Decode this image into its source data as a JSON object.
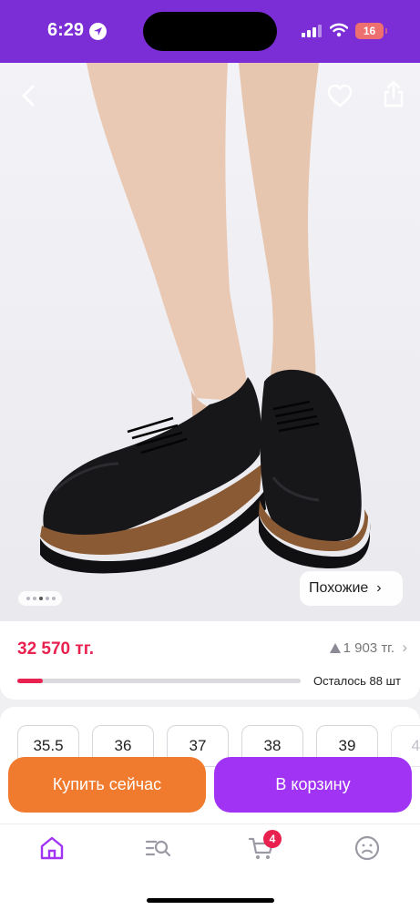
{
  "status_bar": {
    "time": "6:29",
    "battery": "16",
    "icons": [
      "location-arrow-icon",
      "signal-icon",
      "wifi-icon",
      "battery-icon"
    ]
  },
  "product": {
    "gallery": {
      "current_index": 3,
      "total": 5,
      "similar_label": "Похожие",
      "actions": [
        "back-icon",
        "heart-icon",
        "share-icon"
      ]
    },
    "price": "32 570 тг.",
    "installment": "1 903 тг.",
    "stock": {
      "text": "Осталось 88 шт",
      "level_fraction": 0.09
    },
    "sizes": [
      "35.5",
      "36",
      "37",
      "38",
      "39",
      "4"
    ]
  },
  "actions": {
    "buy_now": "Купить сейчас",
    "add_to_cart": "В корзину"
  },
  "tab_bar": {
    "items": [
      "home-icon",
      "catalog-search-icon",
      "cart-icon",
      "profile-icon"
    ],
    "cart_count": "4",
    "active": "home-icon"
  },
  "colors": {
    "brand": "#7b2ed6",
    "price": "#e8214f",
    "buy_now": "#f07a2d",
    "add_to_cart": "#a133f5",
    "active_tab": "#a133f5"
  }
}
